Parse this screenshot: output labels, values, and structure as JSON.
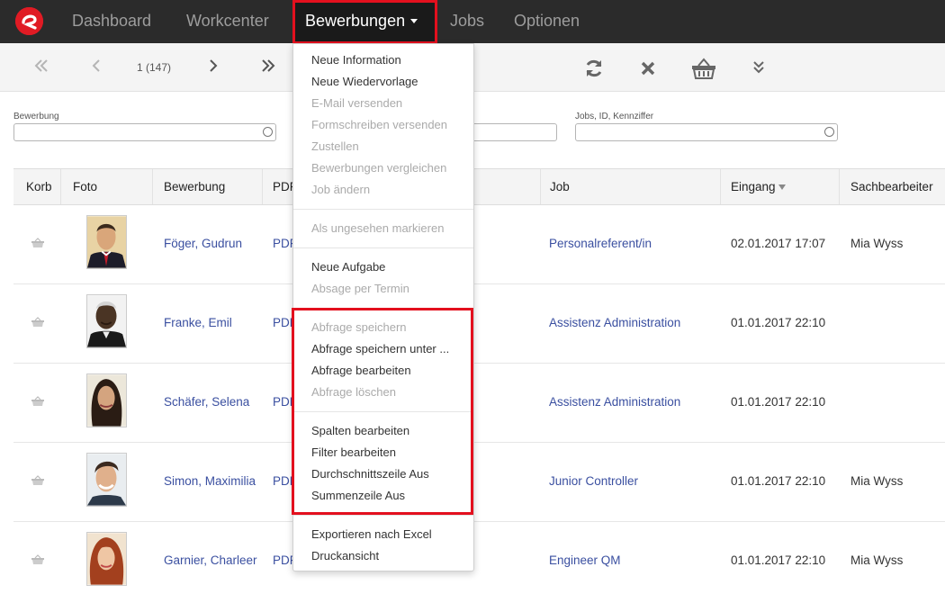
{
  "nav": {
    "items": [
      "Dashboard",
      "Workcenter",
      "Bewerbungen",
      "Jobs",
      "Optionen"
    ],
    "active": "Bewerbungen"
  },
  "toolbar": {
    "pager": "1 (147)"
  },
  "filters": {
    "bewerbung_label": "Bewerbung",
    "jobs_label": "Jobs, ID, Kennziffer"
  },
  "table": {
    "columns": [
      "Korb",
      "Foto",
      "Bewerbung",
      "PDF",
      "Job",
      "Eingang",
      "Sachbearbeiter"
    ],
    "rows": [
      {
        "name": "Föger, Gudrun",
        "pdf": "PDF",
        "job": "Personalreferent/in",
        "date": "02.01.2017 17:07",
        "agent": "Mia Wyss"
      },
      {
        "name": "Franke, Emil",
        "pdf": "PDF",
        "job": "Assistenz Administration",
        "date": "01.01.2017 22:10",
        "agent": ""
      },
      {
        "name": "Schäfer, Selena",
        "pdf": "PDF",
        "job": "Assistenz Administration",
        "date": "01.01.2017 22:10",
        "agent": ""
      },
      {
        "name": "Simon, Maximilia",
        "pdf": "PDF",
        "job": "Junior Controller",
        "date": "01.01.2017 22:10",
        "agent": "Mia Wyss"
      },
      {
        "name": "Garnier, Charleer",
        "pdf": "PDF",
        "job": "Engineer QM",
        "date": "01.01.2017 22:10",
        "agent": "Mia Wyss"
      }
    ]
  },
  "menu": {
    "items": [
      {
        "label": "Neue Information",
        "enabled": true
      },
      {
        "label": "Neue Wiedervorlage",
        "enabled": true
      },
      {
        "label": "E-Mail versenden",
        "enabled": false
      },
      {
        "label": "Formschreiben versenden",
        "enabled": false
      },
      {
        "label": "Zustellen",
        "enabled": false
      },
      {
        "label": "Bewerbungen vergleichen",
        "enabled": false
      },
      {
        "label": "Job ändern",
        "enabled": false
      },
      {
        "label": "Als ungesehen markieren",
        "enabled": false
      },
      {
        "label": "Neue Aufgabe",
        "enabled": true
      },
      {
        "label": "Absage per Termin",
        "enabled": false
      },
      {
        "label": "Abfrage speichern",
        "enabled": false
      },
      {
        "label": "Abfrage speichern unter ...",
        "enabled": true
      },
      {
        "label": "Abfrage bearbeiten",
        "enabled": true
      },
      {
        "label": "Abfrage löschen",
        "enabled": false
      },
      {
        "label": "Spalten bearbeiten",
        "enabled": true
      },
      {
        "label": "Filter bearbeiten",
        "enabled": true
      },
      {
        "label": "Durchschnittszeile Aus",
        "enabled": true
      },
      {
        "label": "Summenzeile Aus",
        "enabled": true
      },
      {
        "label": "Exportieren nach Excel",
        "enabled": true
      },
      {
        "label": "Druckansicht",
        "enabled": true
      }
    ]
  },
  "colors": {
    "highlight": "#e3101e",
    "link": "#3a4fa0",
    "navbar": "#2b2b2b"
  }
}
